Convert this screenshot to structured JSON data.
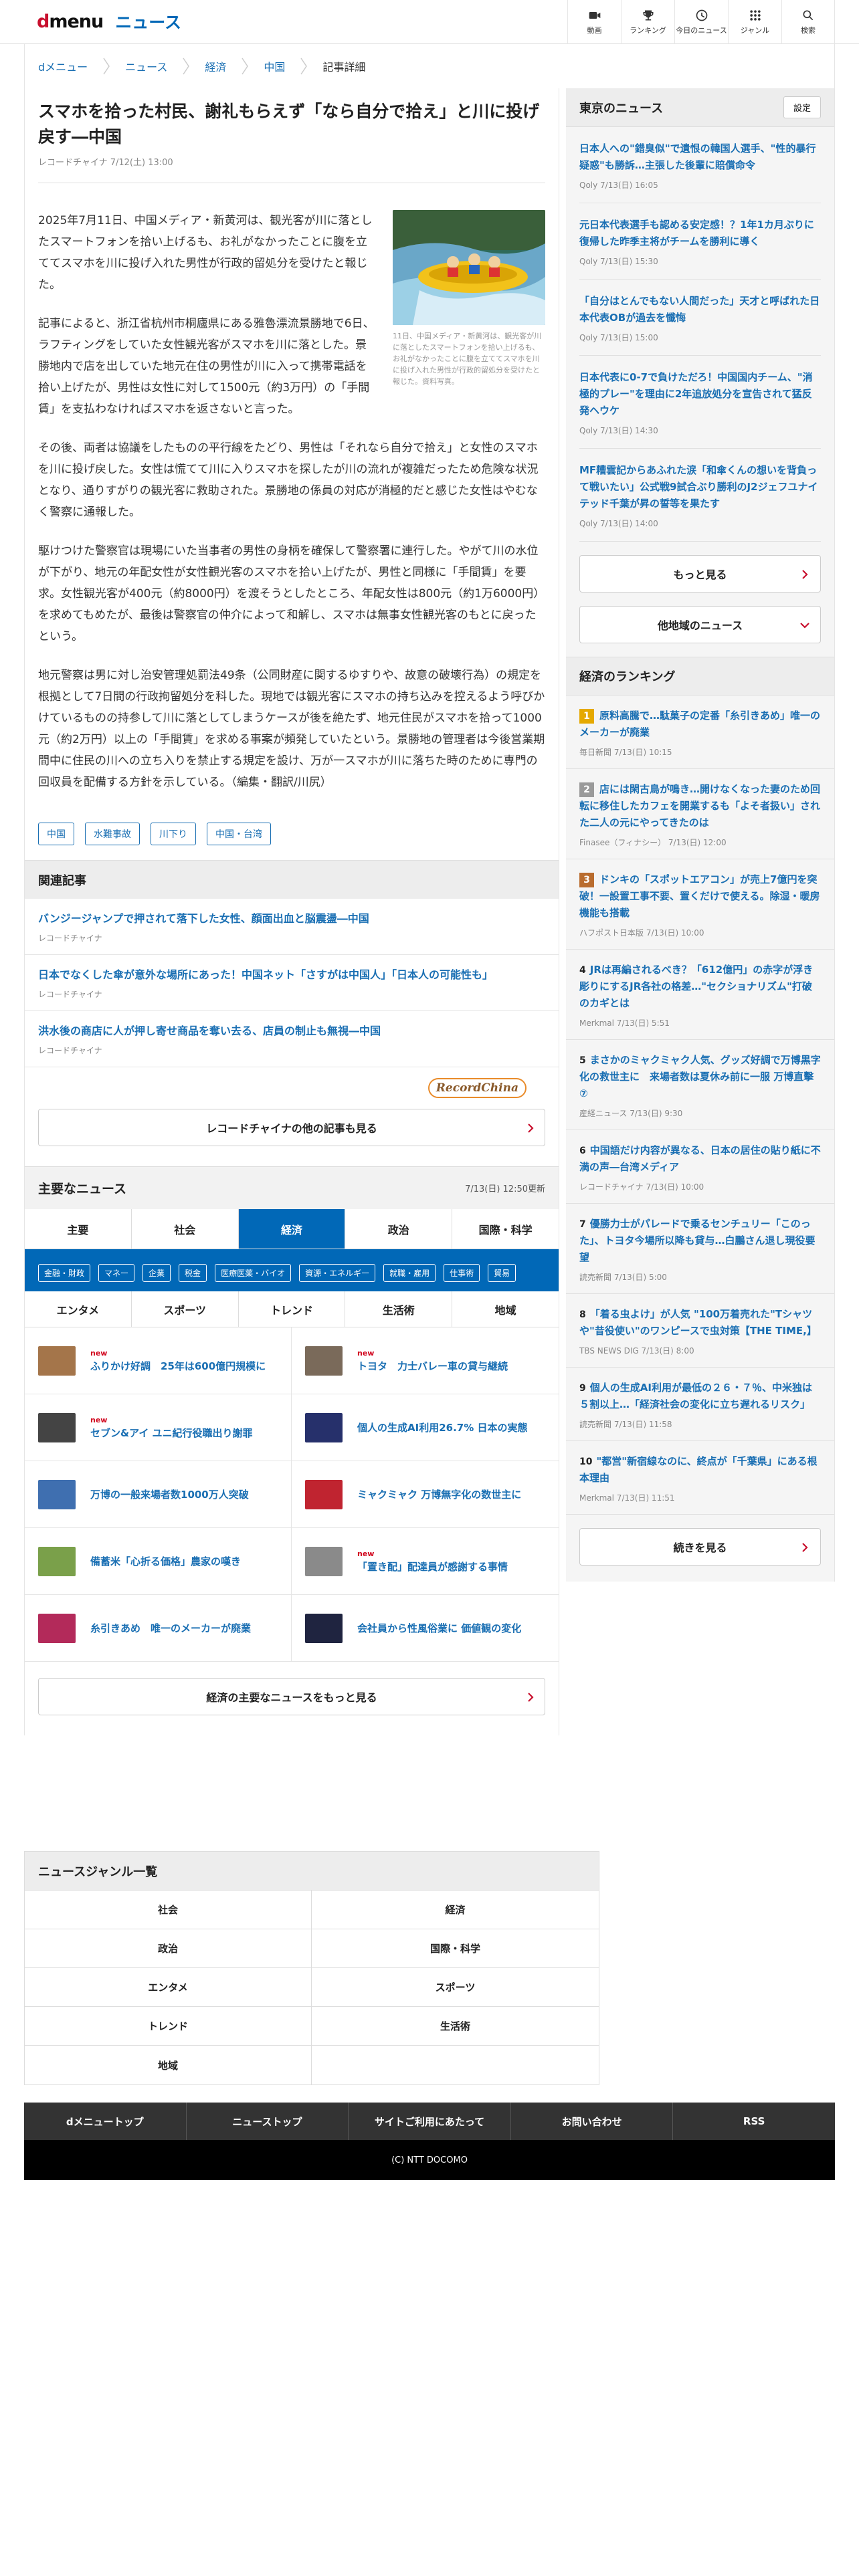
{
  "header": {
    "logo_d": "d",
    "logo_rest": "menu",
    "section": "ニュース",
    "nav": [
      {
        "label": "動画",
        "icon": "video-icon"
      },
      {
        "label": "ランキング",
        "icon": "trophy-icon"
      },
      {
        "label": "今日のニュース",
        "icon": "clock-icon"
      },
      {
        "label": "ジャンル",
        "icon": "grid-icon"
      },
      {
        "label": "検索",
        "icon": "search-icon"
      }
    ]
  },
  "breadcrumb": [
    "dメニュー",
    "ニュース",
    "経済",
    "中国",
    "記事詳細"
  ],
  "article": {
    "title": "スマホを拾った村民、謝礼もらえず「なら自分で拾え」と川に投げ戻す―中国",
    "meta": "レコードチャイナ 7/12(土) 13:00",
    "figure_caption": "11日、中国メディア・新黄河は、観光客が川に落としたスマートフォンを拾い上げるも、お礼がなかったことに腹を立ててスマホを川に投げ入れた男性が行政的留処分を受けたと報じた。資料写真。",
    "paragraphs": [
      "2025年7月11日、中国メディア・新黄河は、観光客が川に落としたスマートフォンを拾い上げるも、お礼がなかったことに腹を立ててスマホを川に投げ入れた男性が行政的留処分を受けたと報じた。",
      "記事によると、浙江省杭州市桐廬県にある雅魯漂流景勝地で6日、ラフティングをしていた女性観光客がスマホを川に落とした。景勝地内で店を出していた地元在住の男性が川に入って携帯電話を拾い上げたが、男性は女性に対して1500元（約3万円）の「手間賃」を支払わなければスマホを返さないと言った。",
      "その後、両者は協議をしたものの平行線をたどり、男性は「それなら自分で拾え」と女性のスマホを川に投げ戻した。女性は慌てて川に入りスマホを探したが川の流れが複雑だったため危険な状況となり、通りすがりの観光客に救助された。景勝地の係員の対応が消極的だと感じた女性はやむなく警察に通報した。",
      "駆けつけた警察官は現場にいた当事者の男性の身柄を確保して警察署に連行した。やがて川の水位が下がり、地元の年配女性が女性観光客のスマホを拾い上げたが、男性と同様に「手間賃」を要求。女性観光客が400元（約8000円）を渡そうとしたところ、年配女性は800元（約1万6000円）を求めてもめたが、最後は警察官の仲介によって和解し、スマホは無事女性観光客のもとに戻ったという。",
      "地元警察は男に対し治安管理処罰法49条（公同財産に関するゆすりや、故意の破壊行為）の規定を根拠として7日間の行政拘留処分を科した。現地では観光客にスマホの持ち込みを控えるよう呼びかけているものの持参して川に落としてしまうケースが後を絶たず、地元住民がスマホを拾って1000元（約2万円）以上の「手間賃」を求める事案が頻発していたという。景勝地の管理者は今後営業期間中に住民の川への立ち入りを禁止する規定を設け、万が一スマホが川に落ちた時のために専門の回収員を配備する方針を示している。（編集・翻訳/川尻）"
    ],
    "tags": [
      "中国",
      "水難事故",
      "川下り",
      "中国・台湾"
    ]
  },
  "related": {
    "heading": "関連記事",
    "items": [
      {
        "title": "バンジージャンプで押されて落下した女性、顔面出血と脳震盪―中国",
        "source": "レコードチャイナ"
      },
      {
        "title": "日本でなくした傘が意外な場所にあった！中国ネット「さすがは中国人」「日本人の可能性も」",
        "source": "レコードチャイナ"
      },
      {
        "title": "洪水後の商店に人が押し寄せ商品を奪い去る、店員の制止も無視―中国",
        "source": "レコードチャイナ"
      }
    ],
    "source_logo": "RecordChina",
    "more_label": "レコードチャイナの他の記事も見る"
  },
  "major": {
    "heading": "主要なニュース",
    "updated": "7/13(日) 12:50更新",
    "tabs1": [
      "主要",
      "社会",
      "経済",
      "政治",
      "国際・科学"
    ],
    "active_tab": "経済",
    "subtags": [
      "金融・財政",
      "マネー",
      "企業",
      "税金",
      "医療医薬・バイオ",
      "資源・エネルギー",
      "就職・雇用",
      "仕事術",
      "貿易"
    ],
    "tabs2": [
      "エンタメ",
      "スポーツ",
      "トレンド",
      "生活術",
      "地域"
    ],
    "new_label": "new",
    "items": [
      {
        "title": "ふりかけ好調　25年は600億円規模に",
        "new": true,
        "thumb_color": "#a4754a"
      },
      {
        "title": "トヨタ　力士バレー車の貸与継続",
        "new": true,
        "thumb_color": "#7a6a5a"
      },
      {
        "title": "セブン&アイ ユニ紀行役職出り謝罪",
        "new": true,
        "thumb_color": "#444444"
      },
      {
        "title": "個人の生成AI利用26.7% 日本の実態",
        "new": false,
        "thumb_color": "#26306b"
      },
      {
        "title": "万博の一般来場者数1000万人突破",
        "new": false,
        "thumb_color": "#3f6fb0"
      },
      {
        "title": "ミャクミャク 万博無字化の数世主に",
        "new": false,
        "thumb_color": "#c02430"
      },
      {
        "title": "備蓄米「心折る価格」農家の嘆き",
        "new": false,
        "thumb_color": "#7aa04a"
      },
      {
        "title": "「置き配」配達員が感謝する事情",
        "new": true,
        "thumb_color": "#8a8a8a"
      },
      {
        "title": "糸引きあめ　唯一のメーカーが廃業",
        "new": false,
        "thumb_color": "#b32a5a"
      },
      {
        "title": "会社員から性風俗業に 価値観の変化",
        "new": false,
        "thumb_color": "#1f2440"
      }
    ],
    "more_label": "経済の主要なニュースをもっと見る"
  },
  "sidebar": {
    "tokyo_heading": "東京のニュース",
    "setting_label": "設定",
    "tokyo_news": [
      {
        "title": "日本人への\"錯臭似\"で遺恨の韓国人選手、\"性的暴行疑惑\"も勝訴…主張した後輩に賠償命令",
        "meta": "Qoly 7/13(日) 16:05"
      },
      {
        "title": "元日本代表選手も認める安定感！？1年1カ月ぶりに復帰した昨季主将がチームを勝利に導く",
        "meta": "Qoly 7/13(日) 15:30"
      },
      {
        "title": "「自分はとんでもない人間だった」天才と呼ばれた日本代表OBが過去を懺悔",
        "meta": "Qoly 7/13(日) 15:00"
      },
      {
        "title": "日本代表に0-7で負けただろ！中国国内チーム、\"消極的プレー\"を理由に2年追放処分を宣告されて猛反発ヘウケ",
        "meta": "Qoly 7/13(日) 14:30"
      },
      {
        "title": "MF糟雲記からあふれた涙「和傘くんの想いを背負って戦いたい」公式戦9試合ぶり勝利のJ2ジェフユナイテッド千葉が昇の誓等を果たす",
        "meta": "Qoly 7/13(日) 14:00"
      }
    ],
    "more_label": "もっと見る",
    "region_label": "他地域のニュース",
    "rank_heading": "経済のランキング",
    "ranking": [
      {
        "rank": "1",
        "title": "原料高騰で…駄菓子の定番「糸引きあめ」唯一のメーカーが廃業",
        "meta": "毎日新聞 7/13(日) 10:15"
      },
      {
        "rank": "2",
        "title": "店には閑古鳥が鳴き…開けなくなった妻のため回転に移住したカフェを開業するも「よそ者扱い」された二人の元にやってきたのは",
        "meta": "Finasee（フィナシー） 7/13(日) 12:00"
      },
      {
        "rank": "3",
        "title": "ドンキの「スポットエアコン」が売上7億円を突破！一設置工事不要、置くだけで使える。除湿・暖房機能も搭載",
        "meta": "ハフポスト日本版 7/13(日) 10:00"
      },
      {
        "rank": "4",
        "title": "JRは再編されるべき？「612億円」の赤字が浮き彫りにするJR各社の格差…\"セクショナリズム\"打破のカギとは",
        "meta": "Merkmal 7/13(日) 5:51"
      },
      {
        "rank": "5",
        "title": "まさかのミャクミャク人気、グッズ好調で万博黒字化の救世主に　来場者数は夏休み前に一服 万博直擊⑦",
        "meta": "産経ニュース 7/13(日) 9:30"
      },
      {
        "rank": "6",
        "title": "中国語だけ内容が異なる、日本の居住の貼り紙に不満の声―台湾メディア",
        "meta": "レコードチャイナ 7/13(日) 10:00"
      },
      {
        "rank": "7",
        "title": "優勝力士がパレードで乗るセンチュリー「このった」、トヨタ今場所以降も貸与…白鵬さん退し現役要望",
        "meta": "読売新聞 7/13(日) 5:00"
      },
      {
        "rank": "8",
        "title": "「着る虫よけ」が人気 \"100万着売れた\"Tシャツや\"昔役使い\"のワンピースで虫対策【THE TIME,】",
        "meta": "TBS NEWS DIG 7/13(日) 8:00"
      },
      {
        "rank": "9",
        "title": "個人の生成AI利用が最低の２６・７％、中米独は５割以上…「経済社会の変化に立ち遅れるリスク」",
        "meta": "読売新聞 7/13(日) 11:58"
      },
      {
        "rank": "10",
        "title": "\"都営\"新宿線なのに、終点が「千葉県」にある根本理由",
        "meta": "Merkmal 7/13(日) 11:51"
      }
    ],
    "rank_more_label": "続きを見る"
  },
  "genre": {
    "heading": "ニュースジャンル一覧",
    "items": [
      "社会",
      "経済",
      "政治",
      "国際・科学",
      "エンタメ",
      "スポーツ",
      "トレンド",
      "生活術",
      "地域"
    ]
  },
  "footer": {
    "links": [
      "dメニュートップ",
      "ニューストップ",
      "サイトご利用にあたって",
      "お問い合わせ",
      "RSS"
    ],
    "copyright": "(C) NTT DOCOMO"
  },
  "colors": {
    "accent": "#0168b7",
    "link": "#1a6fb3",
    "brand_red": "#c8102e",
    "new_red": "#d0021b"
  }
}
